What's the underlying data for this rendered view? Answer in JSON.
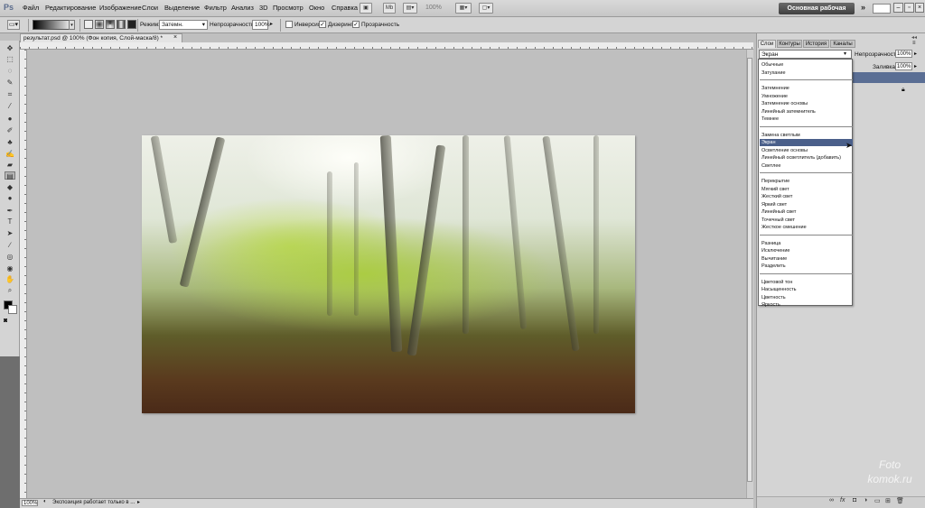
{
  "app": {
    "logo": "Ps"
  },
  "menu": [
    "Файл",
    "Редактирование",
    "Изображение",
    "Слои",
    "Выделение",
    "Фильтр",
    "Анализ",
    "3D",
    "Просмотр",
    "Окно",
    "Справка"
  ],
  "menubar": {
    "zoom": "100%",
    "workspace": "Основная рабочая среда",
    "more": "»",
    "mb_label": "Mb"
  },
  "options": {
    "mode_label": "Режим:",
    "mode_value": "Затемн.",
    "opacity_label": "Непрозрачность:",
    "opacity_value": "100%",
    "inverse_label": "Инверсия",
    "dither_label": "Дизеринг",
    "transparency_label": "Прозрачность"
  },
  "document": {
    "tab_title": "результат.psd @ 100% (Фон копия, Слой-маска/8) *",
    "close_glyph": "×",
    "status_zoom": "100%",
    "status_text": "Экспозиция работает только в ..."
  },
  "panel": {
    "tabs": [
      "Слои",
      "Контуры",
      "История",
      "Каналы"
    ],
    "collapse_label": "◂◂",
    "blend_value": "Экран",
    "opacity_label": "Непрозрачность:",
    "opacity_value": "100%",
    "fill_label": "Заливка:",
    "fill_value": "100%"
  },
  "blend_groups": [
    [
      "Обычные",
      "Затухание"
    ],
    [
      "Затемнение",
      "Умножение",
      "Затемнение основы",
      "Линейный затемнитель",
      "Темнее"
    ],
    [
      "Замена светлым",
      "Экран",
      "Осветление основы",
      "Линейный осветлитель (добавить)",
      "Светлее"
    ],
    [
      "Перекрытие",
      "Мягкий свет",
      "Жесткий свет",
      "Яркий свет",
      "Линейный свет",
      "Точечный свет",
      "Жесткое смешение"
    ],
    [
      "Разница",
      "Исключение",
      "Вычитание",
      "Разделить"
    ],
    [
      "Цветовой тон",
      "Насыщенность",
      "Цветность",
      "Яркость"
    ]
  ],
  "blend_selected": "Экран",
  "watermark": {
    "line1": "Foto",
    "line2": "komok.ru"
  },
  "icons": [
    "ps-logo",
    "gradient-tool-icon",
    "move-tool-icon",
    "lock-icon",
    "cursor-icon",
    "chain-link-icon",
    "fx-icon",
    "trash-icon"
  ]
}
